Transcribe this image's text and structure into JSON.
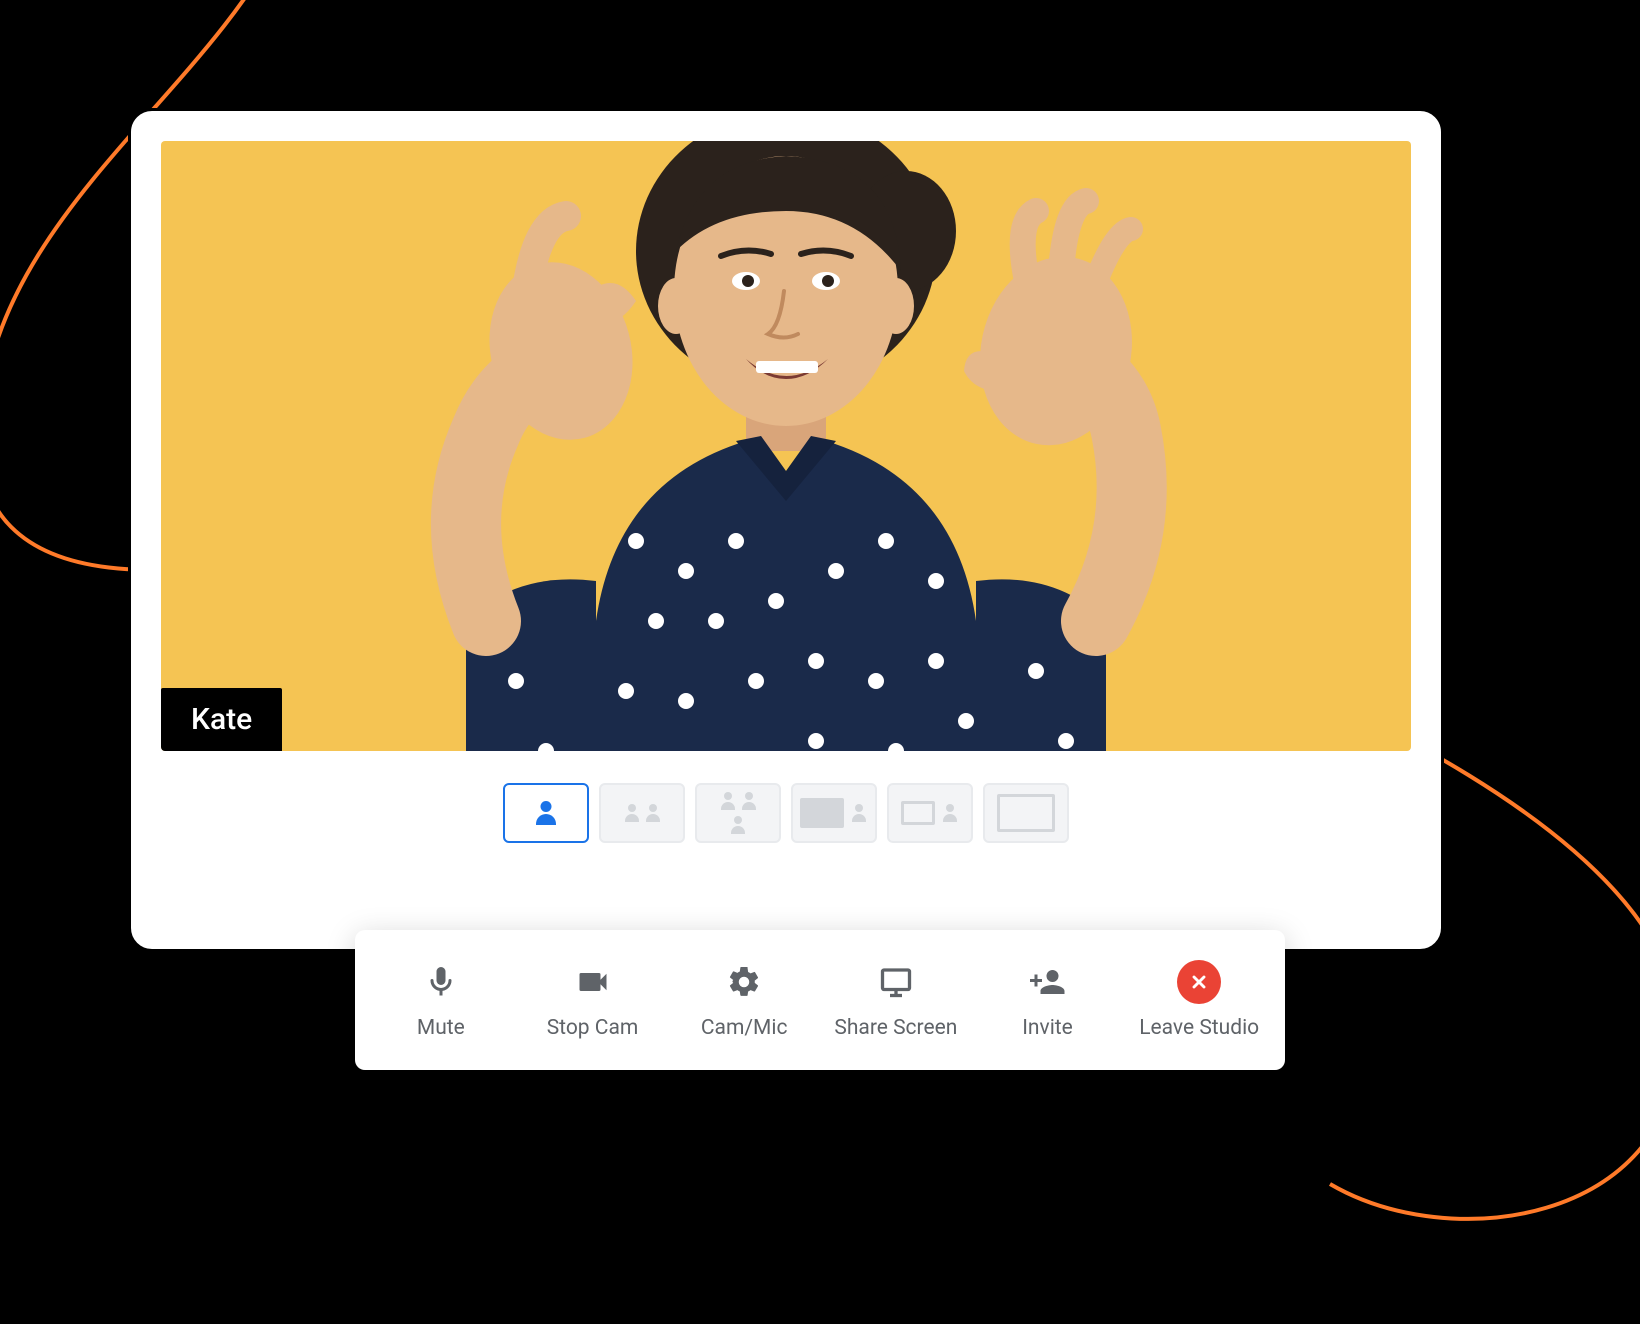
{
  "participant": {
    "name": "Kate"
  },
  "layouts": {
    "active_index": 0,
    "options": [
      "single",
      "two",
      "three",
      "spotlight-one",
      "spotlight-rect",
      "blank"
    ]
  },
  "toolbar": {
    "mute": {
      "label": "Mute",
      "icon": "mic-icon"
    },
    "stop": {
      "label": "Stop Cam",
      "icon": "camera-icon"
    },
    "cammic": {
      "label": "Cam/Mic",
      "icon": "gear-icon"
    },
    "share": {
      "label": "Share Screen",
      "icon": "screen-icon"
    },
    "invite": {
      "label": "Invite",
      "icon": "person-plus-icon"
    },
    "leave": {
      "label": "Leave Studio",
      "icon": "close-icon"
    }
  },
  "colors": {
    "video_bg": "#f5c453",
    "accent": "#1a73e8",
    "danger": "#ea4335",
    "swirl": "#ff7a29"
  }
}
